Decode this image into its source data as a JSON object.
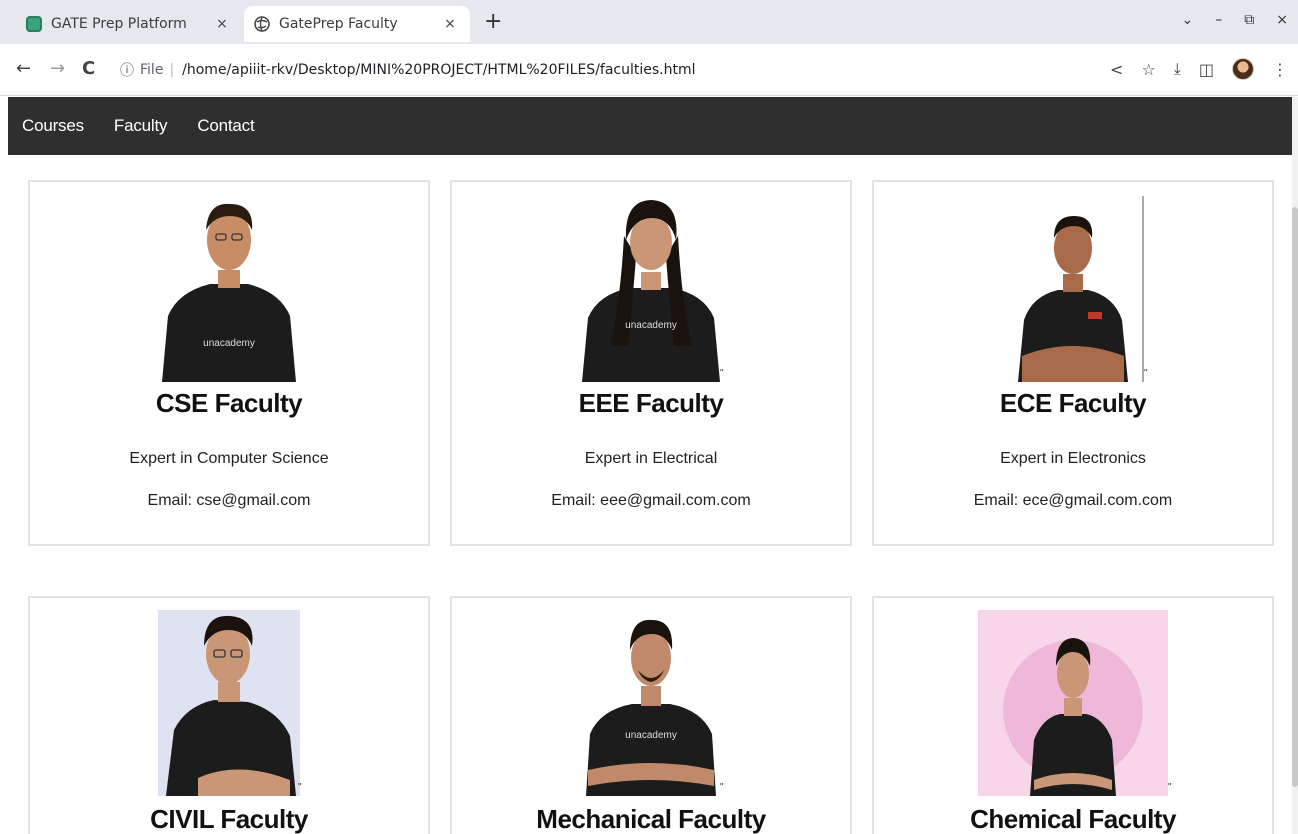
{
  "browser": {
    "tabs": [
      {
        "title": "GATE Prep Platform",
        "close": "×"
      },
      {
        "title": "GatePrep Faculty",
        "close": "×"
      }
    ],
    "new_tab": "+",
    "window_controls": [
      "⌄",
      "–",
      "⧉",
      "×"
    ],
    "nav": {
      "back": "←",
      "forward": "→",
      "reload": "C"
    },
    "omnibox": {
      "info_icon": "ⓘ",
      "scheme": "File",
      "separator": "|",
      "url": "/home/apiiit-rkv/Desktop/MINI%20PROJECT/HTML%20FILES/faculties.html"
    },
    "toolbar_icons": {
      "share": "<",
      "bookmark": "☆",
      "download": "⤓",
      "sidepanel": "◫",
      "menu": "⋮"
    }
  },
  "site_nav": {
    "links": [
      "Courses",
      "Faculty",
      "Contact"
    ]
  },
  "faculties": [
    {
      "title": "CSE Faculty",
      "desc": "Expert in Computer Science",
      "email": "Email: cse@gmail.com",
      "photo_bg": "#ffffff"
    },
    {
      "title": "EEE Faculty",
      "desc": "Expert in Electrical",
      "email": "Email: eee@gmail.com.com",
      "photo_bg": "#ffffff"
    },
    {
      "title": "ECE Faculty",
      "desc": "Expert in Electronics",
      "email": "Email: ece@gmail.com.com",
      "photo_bg": "#ffffff"
    },
    {
      "title": "CIVIL Faculty",
      "desc": "",
      "email": "",
      "photo_bg": "#dfe2f1"
    },
    {
      "title": "Mechanical Faculty",
      "desc": "",
      "email": "",
      "photo_bg": "#ffffff"
    },
    {
      "title": "Chemical Faculty",
      "desc": "",
      "email": "",
      "photo_bg": "#f7d6ea"
    }
  ],
  "colors": {
    "nav_bg": "#2f2f2f",
    "tshirt": "#1c1c1c",
    "card_border": "#e3e3e3"
  },
  "shirt_logo_text": "unacademy"
}
